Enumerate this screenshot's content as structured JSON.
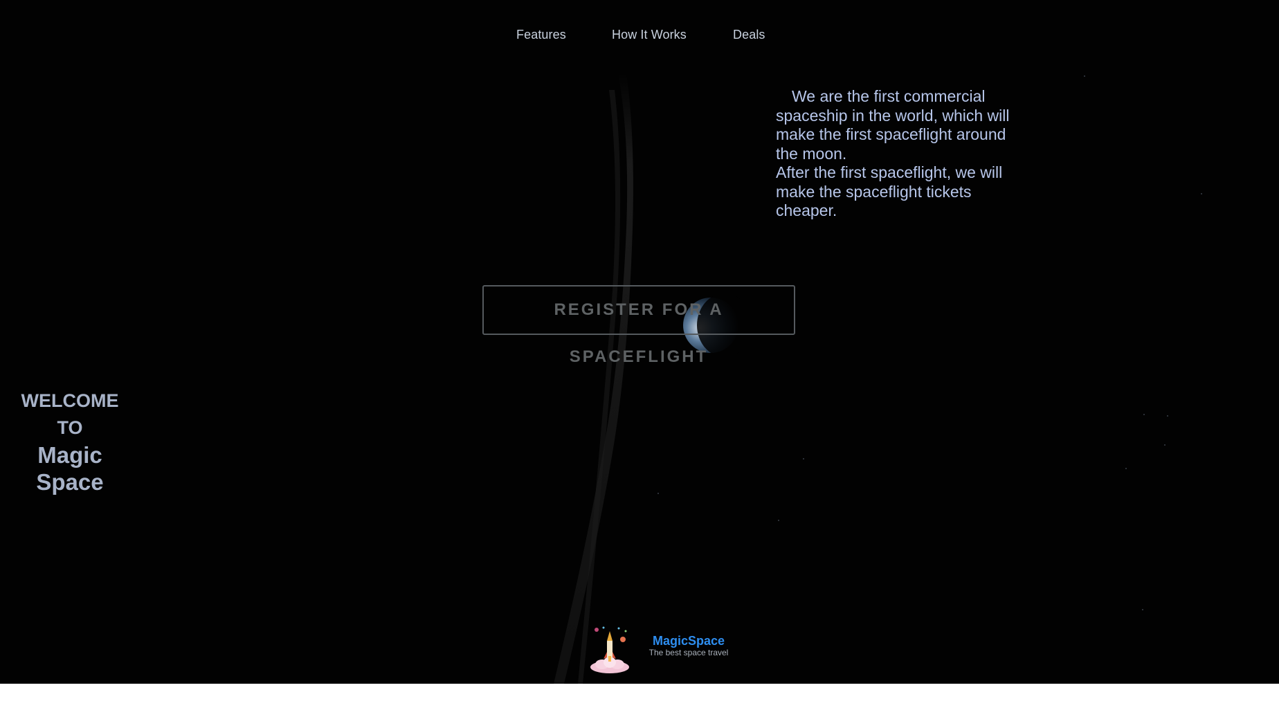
{
  "nav": {
    "items": [
      {
        "label": "Features"
      },
      {
        "label": "How It Works"
      },
      {
        "label": "Deals"
      }
    ]
  },
  "intro": {
    "line1": "We are the first commercial spaceship in the world, which will make the first spaceflight around the moon.",
    "line2": "After the first spaceflight, we will make the spaceflight tickets cheaper."
  },
  "cta": {
    "register_label": "REGISTER FOR A SPACEFLIGHT"
  },
  "welcome": {
    "line1": "WELCOME",
    "line2": "TO",
    "line3": "Magic",
    "line4": "Space"
  },
  "footer": {
    "brand_name": "MagicSpace",
    "tagline": "The best space travel"
  },
  "colors": {
    "background": "#020202",
    "intro_text": "#b7c6ea",
    "brand_accent": "#2e8ef0",
    "welcome_text": "#a8b3c8"
  }
}
